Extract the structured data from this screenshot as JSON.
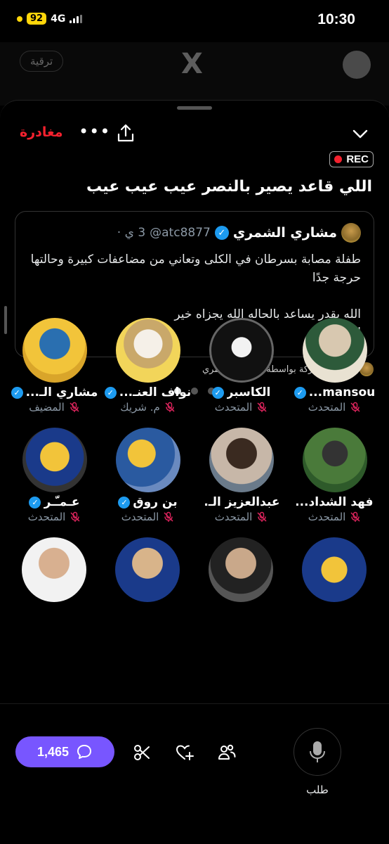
{
  "status_bar": {
    "battery": "92",
    "network": "4G",
    "time": "10:30"
  },
  "background_header": {
    "upgrade_label": "ترقية",
    "logo": "X"
  },
  "space": {
    "leave_label": "مغادرة",
    "more_label": "•••",
    "rec_label": "REC",
    "title": "اللي قاعد يصير بالنصر عيب عيب عيب"
  },
  "pinned_tweet": {
    "author_name": "مشاري الشمري",
    "handle": "@atc8877",
    "time": "3 ي ·",
    "body": "طفلة مصابة بسرطان في الكلى وتعاني من مضاعفات كبيرة وحالتها حرجة جدًا\n\nالله يقدر يساعد بالحاله الله يجزاه خير\nاو ..."
  },
  "shared_by": "تمت المشاركة بواسطة مشاري الشمري",
  "speakers": [
    {
      "name": "mansou...",
      "role": "المتحدث",
      "verified": true,
      "muted": true,
      "role_muted_color": "#e0245e"
    },
    {
      "name": "الكاسبر",
      "role": "المتحدث",
      "verified": true,
      "muted": true,
      "role_muted_color": "#e0245e"
    },
    {
      "name": "نواف العنـ...",
      "role": "م. شريك",
      "verified": true,
      "muted": true,
      "role_muted_color": "#e0245e"
    },
    {
      "name": "مشاري الـ...",
      "role": "المضيف",
      "verified": true,
      "muted": true,
      "role_muted_color": "#e0245e"
    },
    {
      "name": "فهد الشداد...",
      "role": "المتحدث",
      "verified": false,
      "muted": true,
      "role_muted_color": "#e0245e"
    },
    {
      "name": "عبدالعزيز الـ...",
      "role": "المتحدث",
      "verified": false,
      "muted": true,
      "role_muted_color": "#e0245e"
    },
    {
      "name": "بن روق",
      "role": "المتحدث",
      "verified": true,
      "muted": true,
      "role_muted_color": "#e0245e"
    },
    {
      "name": "عـمـّـر",
      "role": "المتحدث",
      "verified": true,
      "muted": true,
      "role_muted_color": "#e0245e"
    }
  ],
  "bottom_bar": {
    "comments_count": "1,465",
    "request_label": "طلب"
  },
  "colors": {
    "accent": "#7856ff",
    "leave": "#f4212e",
    "verified": "#1d9bf0",
    "muted": "#e0245e"
  }
}
